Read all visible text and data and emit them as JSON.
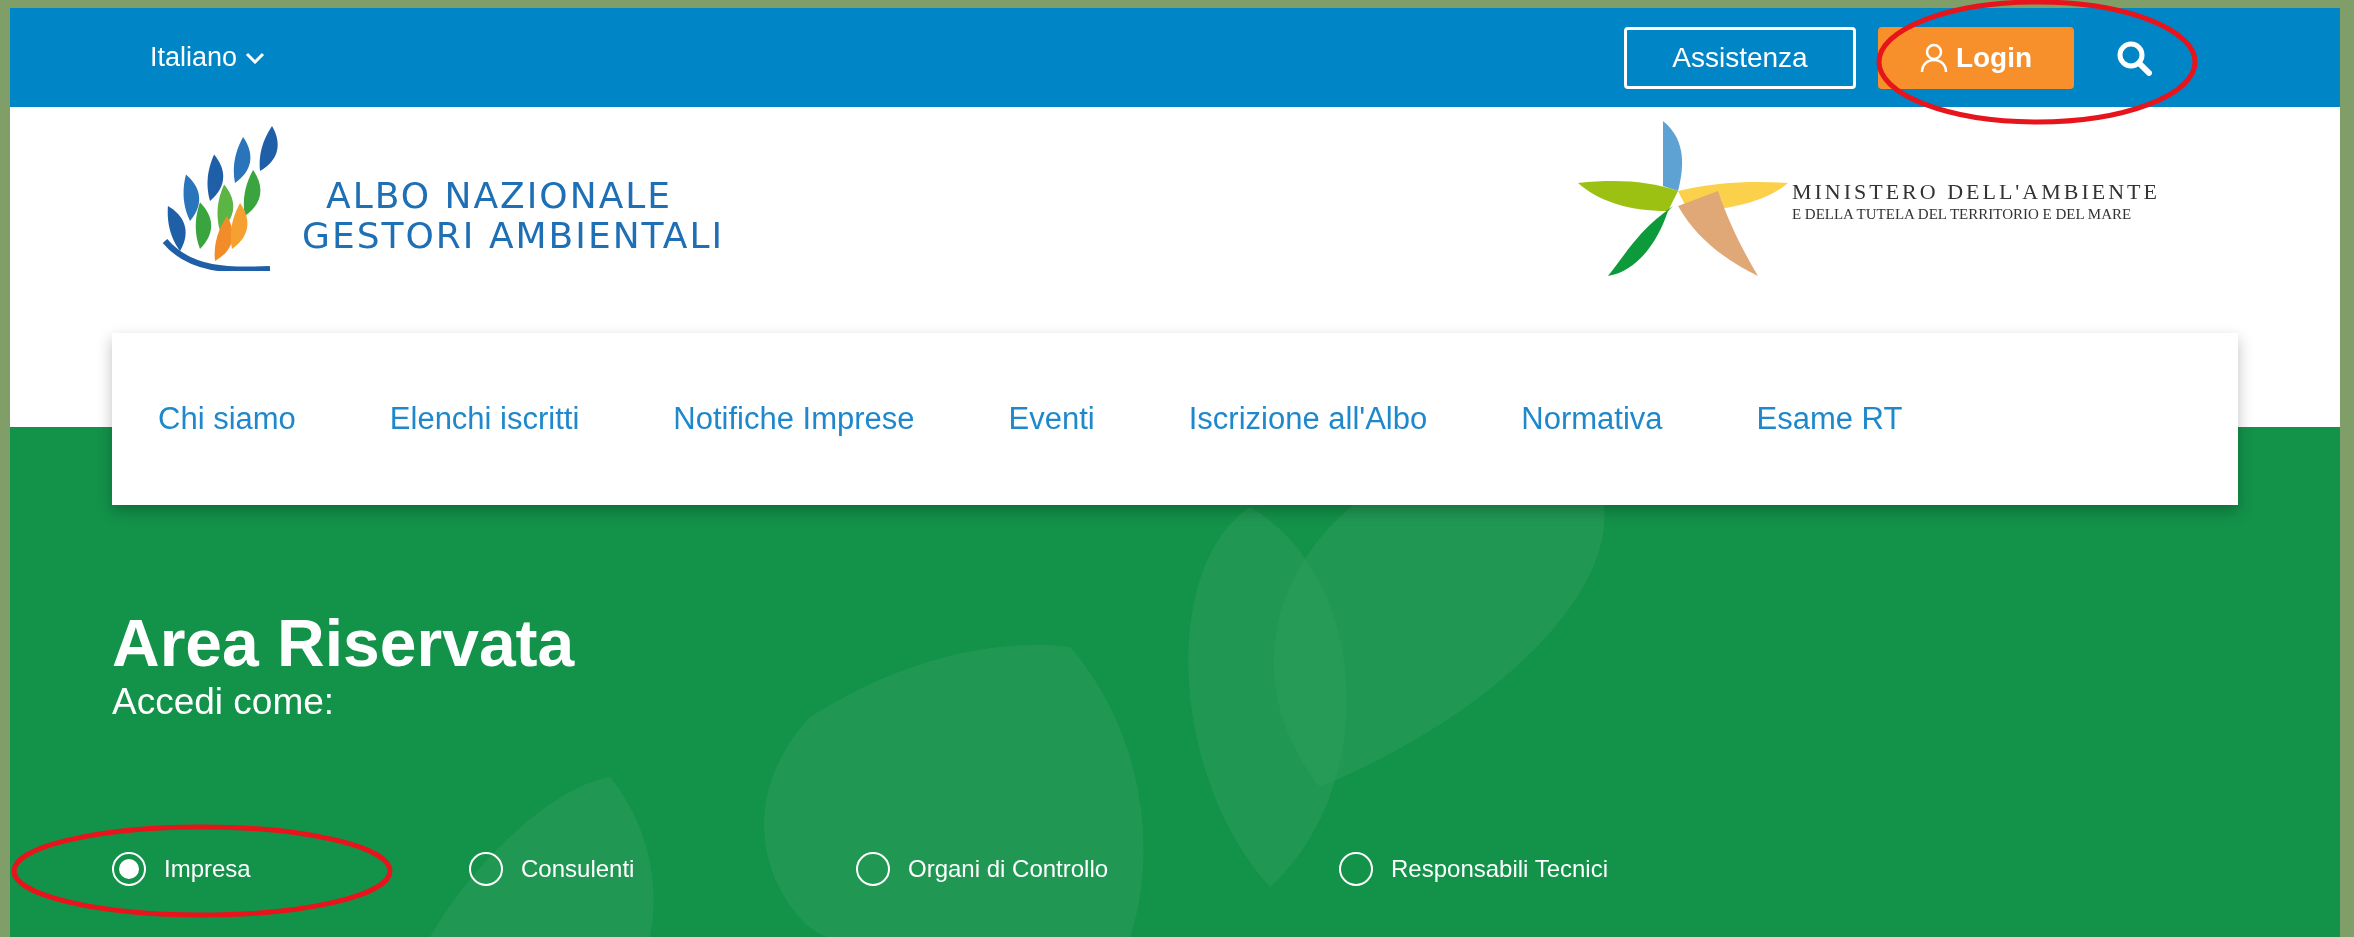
{
  "top_bar": {
    "language": "Italiano",
    "buttons": [
      {
        "label": "Assistenza",
        "kind": "outline"
      },
      {
        "label": "Login",
        "kind": "primary"
      }
    ]
  },
  "logos": {
    "albo": [
      "ALBO NAZIONALE",
      "GESTORI AMBIENTALI"
    ],
    "ministry": [
      "MINISTERO DELL'AMBIENTE",
      "E DELLA TUTELA DEL TERRITORIO E DEL MARE"
    ]
  },
  "nav": [
    {
      "label": "Chi siamo"
    },
    {
      "label": "Elenchi iscritti"
    },
    {
      "label": "Notifiche Imprese"
    },
    {
      "label": "Eventi"
    },
    {
      "label": "Iscrizione all'Albo"
    },
    {
      "label": "Normativa"
    },
    {
      "label": "Esame RT"
    }
  ],
  "hero": {
    "title": "Area Riservata",
    "subtitle": "Accedi come:"
  },
  "roles": [
    {
      "label": "Impresa",
      "selected": true
    },
    {
      "label": "Consulenti",
      "selected": false
    },
    {
      "label": "Organi di Controllo",
      "selected": false
    },
    {
      "label": "Responsabili Tecnici",
      "selected": false
    }
  ]
}
